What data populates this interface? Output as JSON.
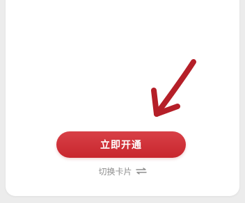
{
  "open_button": {
    "label": "立即开通"
  },
  "switch_card": {
    "label": "切换卡片",
    "icon": "swap-arrows-icon"
  },
  "colors": {
    "primary_red": "#c8262d",
    "annotation_red": "#b51f28",
    "secondary_text": "#8e8e8e",
    "background": "#ececec",
    "card": "#ffffff"
  }
}
